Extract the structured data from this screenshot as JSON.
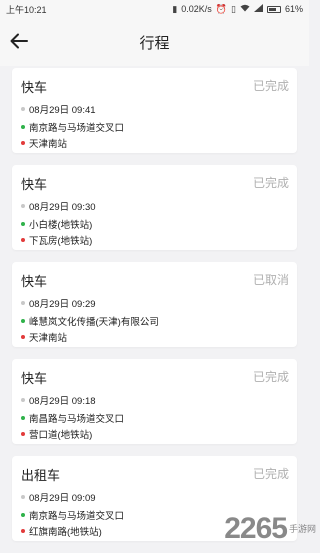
{
  "status_bar": {
    "time": "上午10:21",
    "net_speed": "0.02K/s",
    "battery": "61%",
    "icons": [
      "signal-icon",
      "alarm-icon",
      "vibrate-icon",
      "wifi-icon",
      "cellular-icon",
      "battery-icon"
    ]
  },
  "header": {
    "title": "行程",
    "back_icon": "arrow-left-icon"
  },
  "trips": [
    {
      "type": "快车",
      "status": "已完成",
      "time": "08月29日 09:41",
      "from": "南京路与马场道交叉口",
      "to": "天津南站"
    },
    {
      "type": "快车",
      "status": "已完成",
      "time": "08月29日 09:30",
      "from": "小白楼(地铁站)",
      "to": "下瓦房(地铁站)"
    },
    {
      "type": "快车",
      "status": "已取消",
      "time": "08月29日 09:29",
      "from": "峰慧岚文化传播(天津)有限公司",
      "to": "天津南站"
    },
    {
      "type": "快车",
      "status": "已完成",
      "time": "08月29日 09:18",
      "from": "南昌路与马场道交叉口",
      "to": "营口道(地铁站)"
    },
    {
      "type": "出租车",
      "status": "已完成",
      "time": "08月29日 09:09",
      "from": "南京路与马场道交叉口",
      "to": "红旗南路(地铁站)"
    }
  ],
  "watermark": {
    "number": "2265",
    "text": "手游网"
  },
  "colors": {
    "from_dot": "#2fb24a",
    "to_dot": "#e23b3b",
    "time_dot": "#c8c8c8",
    "status_text": "#b0b0b0"
  }
}
